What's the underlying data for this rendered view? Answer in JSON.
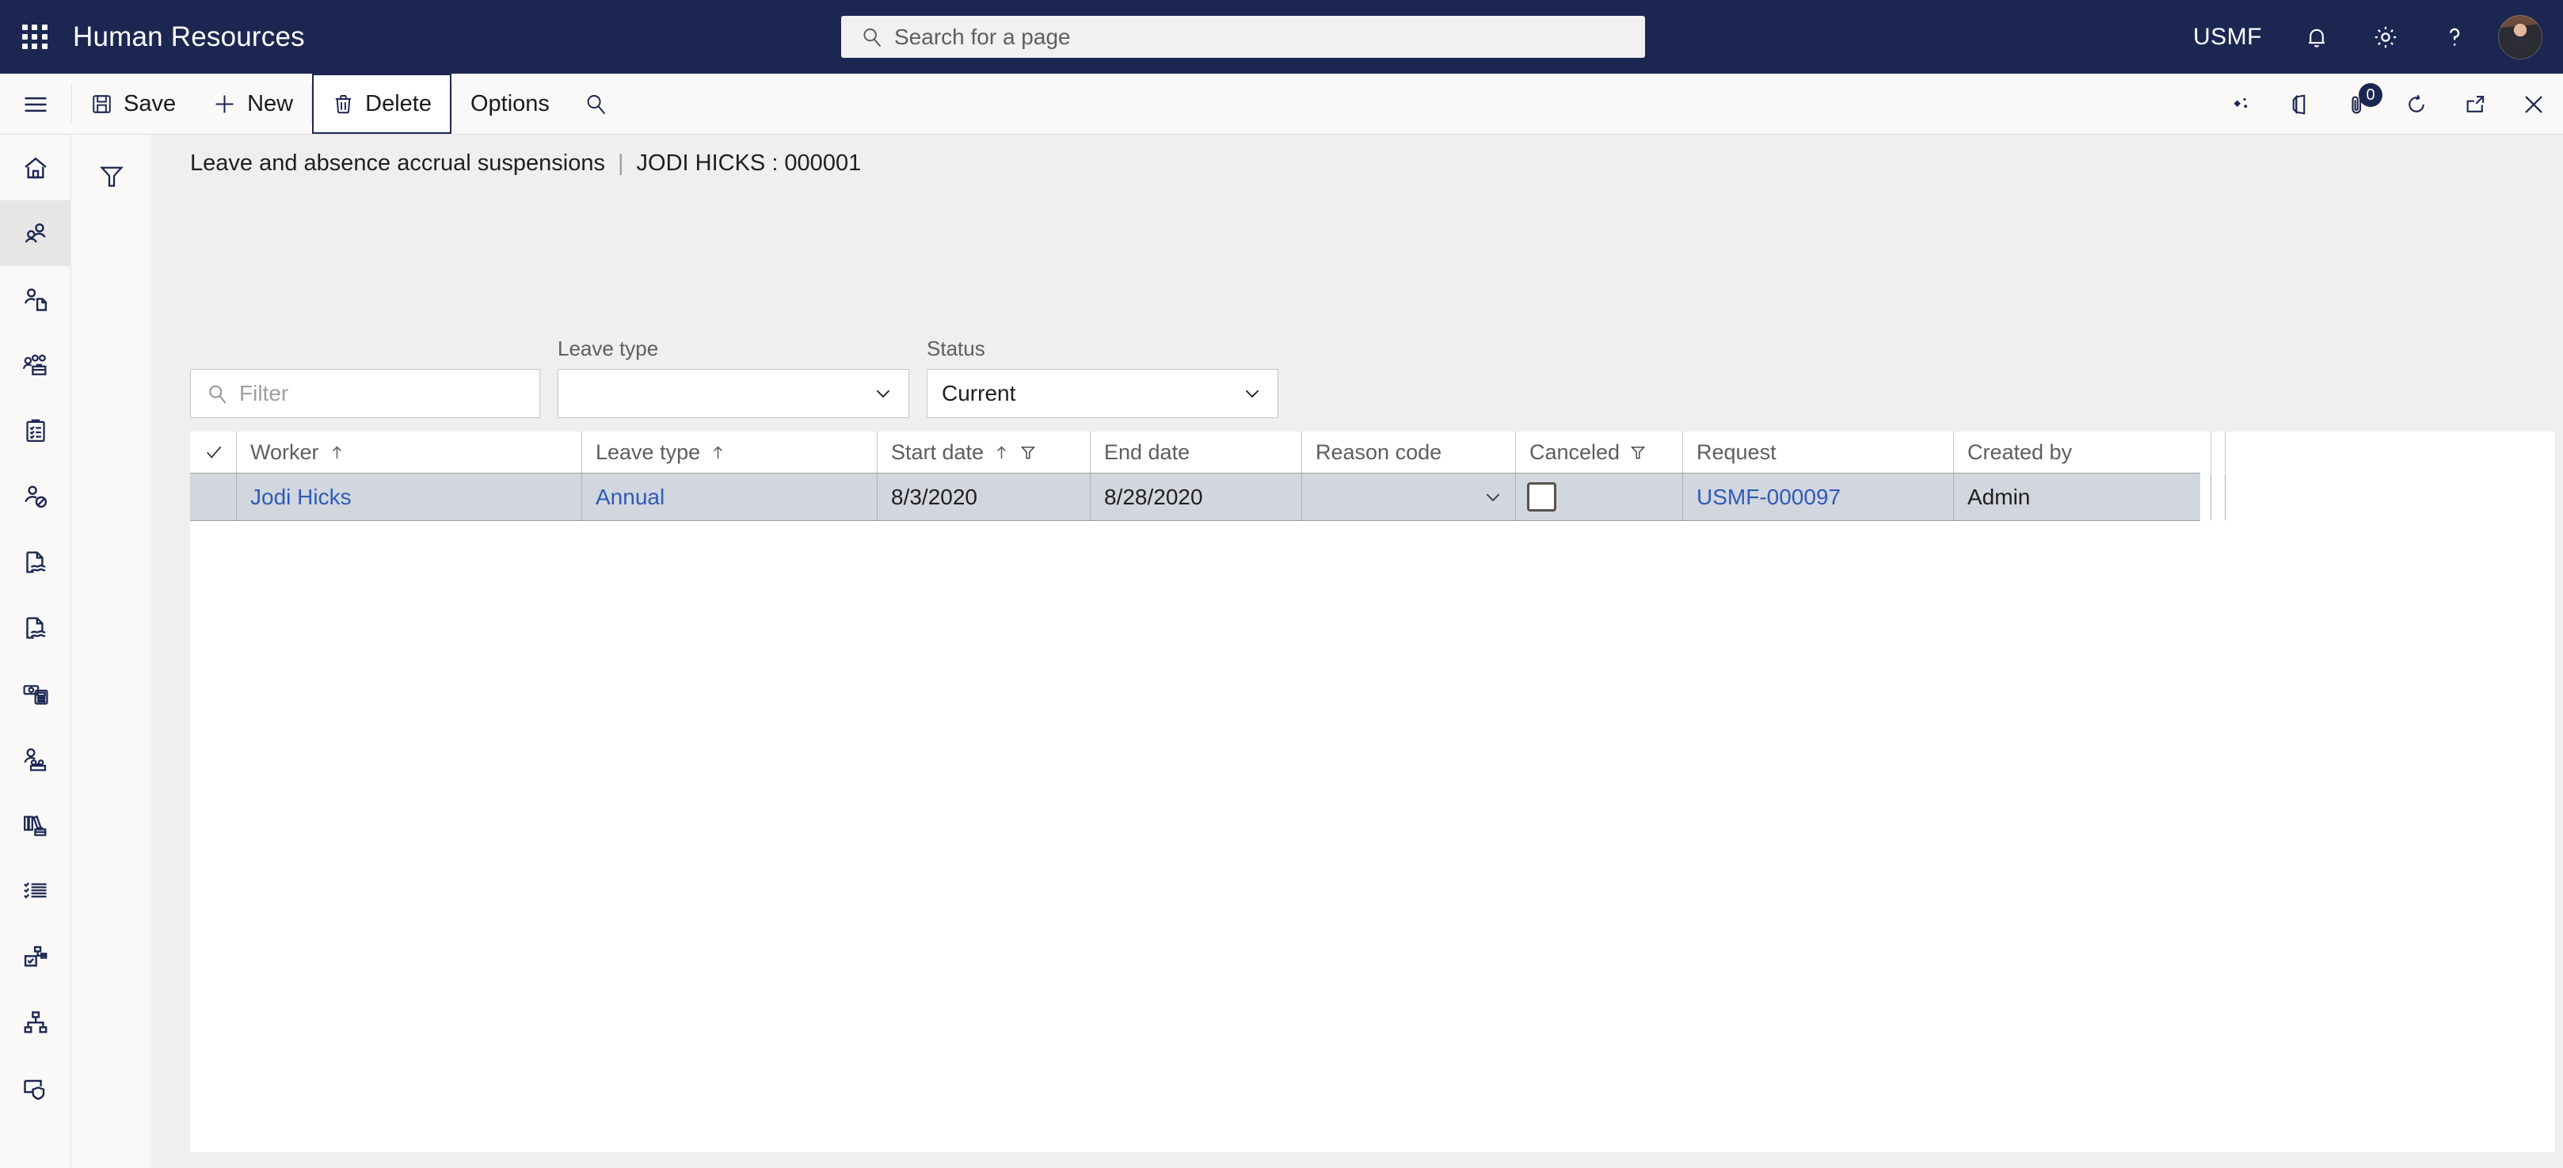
{
  "topbar": {
    "waffle_icon": "waffle-grid-icon",
    "app_title": "Human Resources",
    "search": {
      "icon": "search-icon",
      "placeholder": "Search for a page",
      "value": ""
    },
    "company_label": "USMF",
    "notifications_icon": "bell-icon",
    "settings_icon": "gear-icon",
    "help_icon": "question-mark-icon",
    "avatar": "user-avatar",
    "bg_color": "#1c2751"
  },
  "commandbar": {
    "hamburger_icon": "hamburger-menu-icon",
    "buttons": [
      {
        "label": "Save",
        "icon": "save-disk-icon",
        "focused": false
      },
      {
        "label": "New",
        "icon": "plus-icon",
        "focused": false
      },
      {
        "label": "Delete",
        "icon": "trash-can-icon",
        "focused": true
      },
      {
        "label": "Options",
        "icon": "",
        "focused": false
      }
    ],
    "search_icon": "search-icon",
    "right_icons": [
      {
        "name": "sparkle-diamond-icon",
        "badge": null
      },
      {
        "name": "office-apps-icon",
        "badge": null
      },
      {
        "name": "attachment-clip-icon",
        "badge": "0"
      },
      {
        "name": "refresh-circle-icon",
        "badge": null
      },
      {
        "name": "open-in-new-window-icon",
        "badge": null
      },
      {
        "name": "close-x-icon",
        "badge": null
      }
    ]
  },
  "rail": {
    "items": [
      {
        "icon": "home-icon",
        "label": "Home",
        "active": false
      },
      {
        "icon": "people-group-icon",
        "label": "Workforce management",
        "active": true
      },
      {
        "icon": "person-document-icon",
        "label": "Recruitment",
        "active": false
      },
      {
        "icon": "people-briefcase-icon",
        "label": "Teams",
        "active": false
      },
      {
        "icon": "clipboard-checklist-icon",
        "label": "Tasks",
        "active": false
      },
      {
        "icon": "person-absence-icon",
        "label": "Leave and absence",
        "active": false
      },
      {
        "icon": "document-signature-icon",
        "label": "Employment",
        "active": false
      },
      {
        "icon": "document-signature-2-icon",
        "label": "Contracts",
        "active": false
      },
      {
        "icon": "money-calculator-icon",
        "label": "Compensation",
        "active": false
      },
      {
        "icon": "person-benefits-icon",
        "label": "Benefits",
        "active": false
      },
      {
        "icon": "books-briefcase-icon",
        "label": "Learning",
        "active": false
      },
      {
        "icon": "checklist-lines-icon",
        "label": "Questionnaires",
        "active": false
      },
      {
        "icon": "org-checkbox-icon",
        "label": "Positions",
        "active": false
      },
      {
        "icon": "hierarchy-icon",
        "label": "Organization",
        "active": false
      },
      {
        "icon": "screen-shield-icon",
        "label": "Security",
        "active": false
      }
    ]
  },
  "filterpane": {
    "funnel_icon": "filter-funnel-icon"
  },
  "page": {
    "title": "Leave and absence accrual suspensions",
    "separator": "|",
    "record": "JODI HICKS : 000001"
  },
  "quickfilters": {
    "filter": {
      "label": "",
      "icon": "search-icon",
      "placeholder": "Filter",
      "value": ""
    },
    "leave_type": {
      "label": "Leave type",
      "value": "",
      "chevron": "chevron-down-icon"
    },
    "status": {
      "label": "Status",
      "value": "Current",
      "chevron": "chevron-down-icon"
    }
  },
  "grid": {
    "columns": [
      {
        "key": "check",
        "label": "",
        "icon": "checkmark-icon",
        "sort": "",
        "filter": false
      },
      {
        "key": "worker",
        "label": "Worker",
        "icon": "",
        "sort": "up",
        "filter": false
      },
      {
        "key": "leave",
        "label": "Leave type",
        "icon": "",
        "sort": "up",
        "filter": false
      },
      {
        "key": "start",
        "label": "Start date",
        "icon": "",
        "sort": "up",
        "filter": true
      },
      {
        "key": "end",
        "label": "End date",
        "icon": "",
        "sort": "",
        "filter": false
      },
      {
        "key": "reason",
        "label": "Reason code",
        "icon": "",
        "sort": "",
        "filter": false
      },
      {
        "key": "canceled",
        "label": "Canceled",
        "icon": "",
        "sort": "",
        "filter": true
      },
      {
        "key": "request",
        "label": "Request",
        "icon": "",
        "sort": "",
        "filter": false
      },
      {
        "key": "createdby",
        "label": "Created by",
        "icon": "",
        "sort": "",
        "filter": false
      }
    ],
    "rows": [
      {
        "selected": true,
        "worker": "Jodi Hicks",
        "leave_type": "Annual",
        "start_date": "8/3/2020",
        "end_date": "8/28/2020",
        "reason_code": "",
        "reason_chevron": "chevron-down-icon",
        "canceled_checked": false,
        "request": "USMF-000097",
        "created_by": "Admin"
      }
    ],
    "row_selected_bg": "#d2d6df",
    "link_color": "#2f5bb7"
  }
}
